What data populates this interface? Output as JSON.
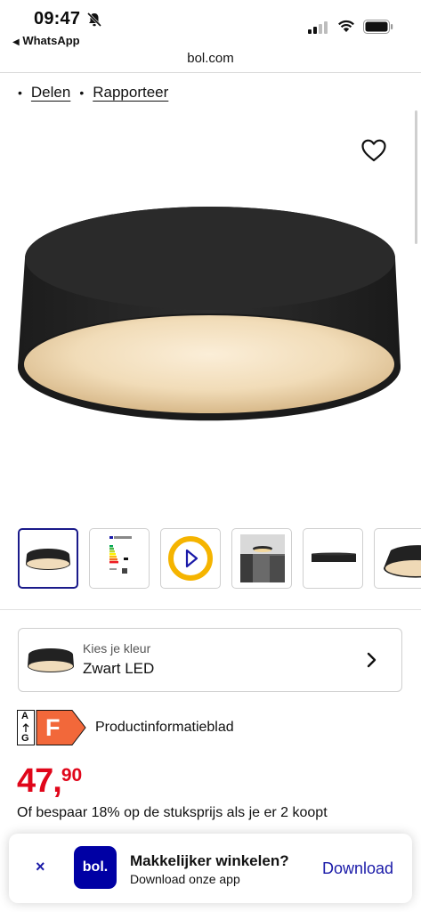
{
  "status_bar": {
    "time": "09:47",
    "back_app": "WhatsApp"
  },
  "browser": {
    "url": "bol.com"
  },
  "links": [
    "Delen",
    "Rapporteer"
  ],
  "product": {
    "color_label": "Kies je kleur",
    "color_value": "Zwart LED",
    "energy_class": "F",
    "energy_scale_top": "A",
    "energy_scale_bottom": "G",
    "product_info_label": "Productinformatieblad",
    "price_whole": "47",
    "price_sep": ",",
    "price_cents": "90",
    "offer_text": "Of bespaar 18% op de stuksprijs als je er 2 koopt"
  },
  "banner": {
    "close": "×",
    "logo_text": "bol.",
    "title": "Makkelijker winkelen?",
    "subtitle": "Download onze app",
    "download_label": "Download"
  },
  "colors": {
    "brand_blue": "#0000a4",
    "price_red": "#e0061a",
    "energy_orange": "#f2683a"
  },
  "icons": [
    "bell-slash-icon",
    "signal-icon",
    "wifi-icon",
    "battery-icon",
    "heart-icon",
    "chevron-right-icon",
    "play-icon",
    "close-icon"
  ]
}
